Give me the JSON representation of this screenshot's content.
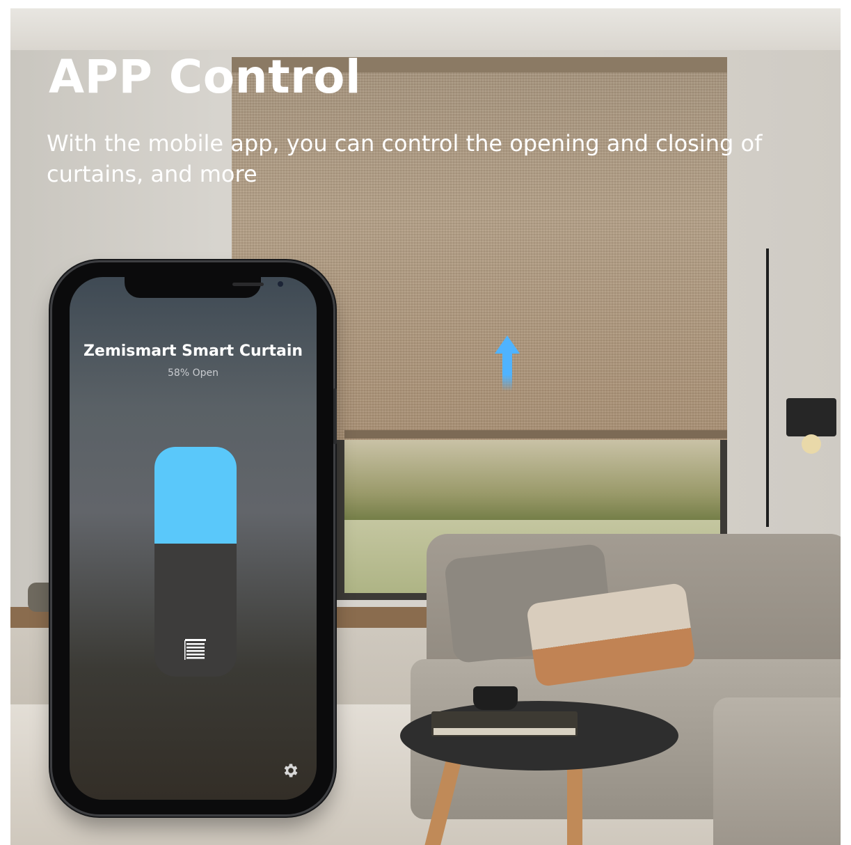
{
  "banner": {
    "title": "APP Control",
    "subtitle": "With the mobile app, you can control the opening and closing of curtains, and more"
  },
  "app": {
    "device_name": "Zemismart Smart Curtain",
    "status": "58% Open",
    "open_percent": 58,
    "icons": {
      "blinds": "blinds-icon",
      "settings": "gear-icon",
      "raise": "arrow-up-icon"
    },
    "colors": {
      "accent": "#5ac8fa",
      "slider_track": "#3d3c3b"
    }
  }
}
